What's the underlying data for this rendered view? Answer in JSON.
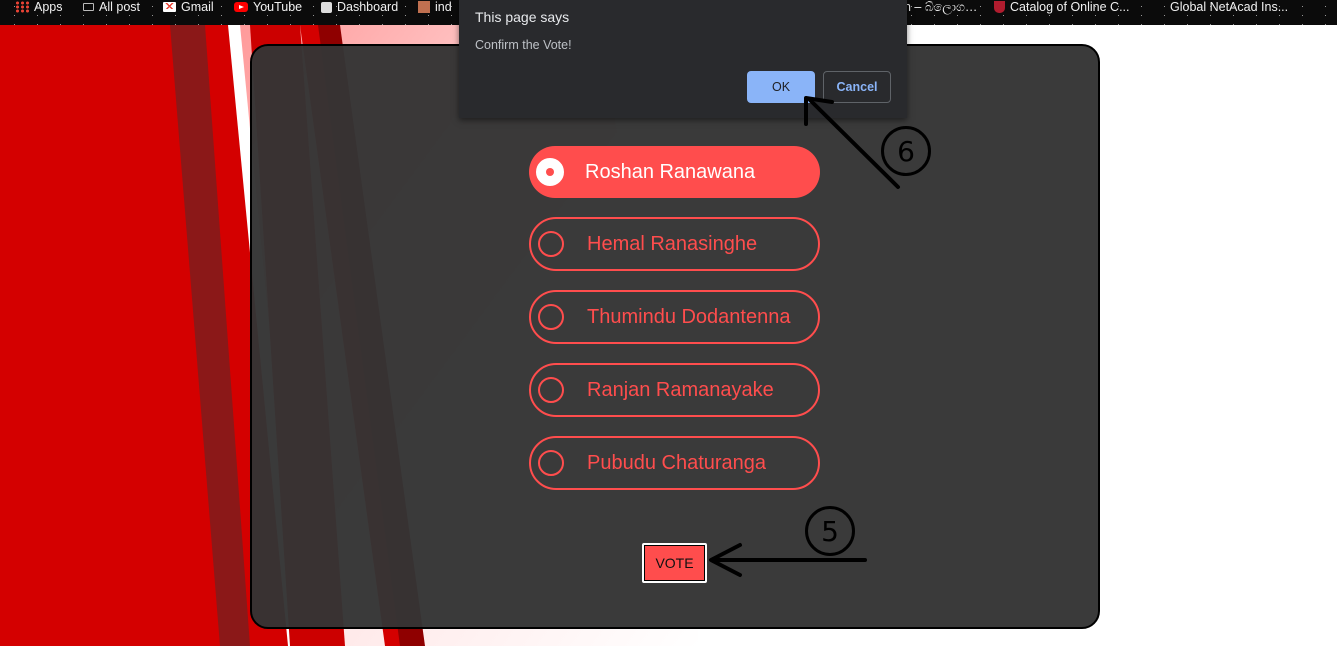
{
  "bookmarks": [
    {
      "label": "Apps",
      "icon": "apps-grid-icon"
    },
    {
      "label": "All post",
      "icon": "monitor-icon"
    },
    {
      "label": "Gmail",
      "icon": "gmail-icon"
    },
    {
      "label": "YouTube",
      "icon": "youtube-icon"
    },
    {
      "label": "Dashboard",
      "icon": "dashboard-icon"
    },
    {
      "label": "ind",
      "icon": "site-icon"
    },
    {
      "label": "n – බ්ලොග…",
      "icon": ""
    },
    {
      "label": "Catalog of Online C...",
      "icon": "shield-crest-icon"
    },
    {
      "label": "Global NetAcad Ins...",
      "icon": ""
    }
  ],
  "dialog": {
    "title": "This page says",
    "message": "Confirm the Vote!",
    "ok_label": "OK",
    "cancel_label": "Cancel"
  },
  "candidates": [
    {
      "name": "Roshan Ranawana",
      "selected": true
    },
    {
      "name": "Hemal Ranasinghe",
      "selected": false
    },
    {
      "name": "Thumindu Dodantenna",
      "selected": false
    },
    {
      "name": "Ranjan Ramanayake",
      "selected": false
    },
    {
      "name": "Pubudu Chaturanga",
      "selected": false
    }
  ],
  "vote_button": {
    "label": "VOTE"
  },
  "annotations": [
    {
      "step": "5"
    },
    {
      "step": "6"
    }
  ],
  "colors": {
    "accent": "#ff4d4d",
    "panel": "#343434",
    "dialog_bg": "#292a2d",
    "dialog_ok": "#8ab4f8",
    "background_red": "#d40000"
  }
}
